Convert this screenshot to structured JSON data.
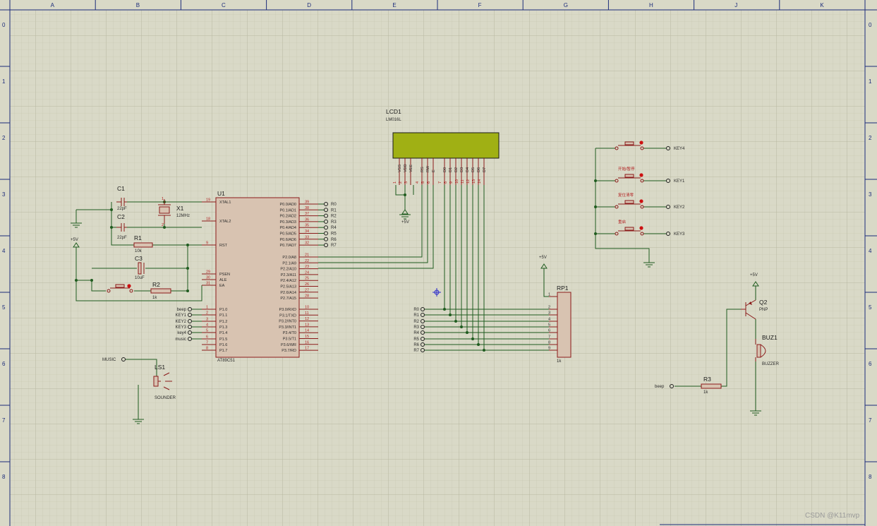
{
  "frame": {
    "columns": [
      "A",
      "B",
      "C",
      "D",
      "E",
      "F",
      "G",
      "H",
      "J",
      "K"
    ],
    "rows": [
      "0",
      "1",
      "2",
      "3",
      "4",
      "5",
      "6",
      "7",
      "8"
    ]
  },
  "components": {
    "u1": {
      "ref": "U1",
      "part": "AT89C51",
      "left_pins": [
        {
          "num": "19",
          "name": "XTAL1"
        },
        {
          "num": "18",
          "name": "XTAL2"
        },
        {
          "num": "9",
          "name": "RST"
        },
        {
          "num": "29",
          "name": "PSEN"
        },
        {
          "num": "30",
          "name": "ALE"
        },
        {
          "num": "31",
          "name": "EA"
        },
        {
          "num": "1",
          "name": "P1.0"
        },
        {
          "num": "2",
          "name": "P1.1"
        },
        {
          "num": "3",
          "name": "P1.2"
        },
        {
          "num": "4",
          "name": "P1.3"
        },
        {
          "num": "5",
          "name": "P1.4"
        },
        {
          "num": "6",
          "name": "P1.5"
        },
        {
          "num": "7",
          "name": "P1.6"
        },
        {
          "num": "8",
          "name": "P1.7"
        }
      ],
      "right_pins": [
        {
          "num": "39",
          "name": "P0.0/AD0"
        },
        {
          "num": "38",
          "name": "P0.1/AD1"
        },
        {
          "num": "37",
          "name": "P0.2/AD2"
        },
        {
          "num": "36",
          "name": "P0.3/AD3"
        },
        {
          "num": "35",
          "name": "P0.4/AD4"
        },
        {
          "num": "34",
          "name": "P0.5/AD5"
        },
        {
          "num": "33",
          "name": "P0.6/AD6"
        },
        {
          "num": "32",
          "name": "P0.7/AD7"
        },
        {
          "num": "21",
          "name": "P2.0/A8"
        },
        {
          "num": "22",
          "name": "P2.1/A9"
        },
        {
          "num": "23",
          "name": "P2.2/A10"
        },
        {
          "num": "24",
          "name": "P2.3/A11"
        },
        {
          "num": "25",
          "name": "P2.4/A12"
        },
        {
          "num": "26",
          "name": "P2.5/A13"
        },
        {
          "num": "27",
          "name": "P2.6/A14"
        },
        {
          "num": "28",
          "name": "P2.7/A15"
        },
        {
          "num": "10",
          "name": "P3.0/RXD"
        },
        {
          "num": "11",
          "name": "P3.1/TXD"
        },
        {
          "num": "12",
          "name": "P3.2/INT0"
        },
        {
          "num": "13",
          "name": "P3.3/INT1"
        },
        {
          "num": "14",
          "name": "P3.4/T0"
        },
        {
          "num": "15",
          "name": "P3.5/T1"
        },
        {
          "num": "16",
          "name": "P3.6/WR"
        },
        {
          "num": "17",
          "name": "P3.7/RD"
        }
      ]
    },
    "c1": {
      "ref": "C1",
      "value": "22pF"
    },
    "c2": {
      "ref": "C2",
      "value": "22pF"
    },
    "c3": {
      "ref": "C3",
      "value": "10uF"
    },
    "x1": {
      "ref": "X1",
      "value": "12MHz"
    },
    "r1": {
      "ref": "R1",
      "value": "10k"
    },
    "r2": {
      "ref": "R2",
      "value": "1k"
    },
    "r3": {
      "ref": "R3",
      "value": "1k"
    },
    "lcd1": {
      "ref": "LCD1",
      "part": "LM016L",
      "pin_names": [
        "VSS",
        "VDD",
        "VEE",
        "RS",
        "RW",
        "E",
        "D0",
        "D1",
        "D2",
        "D3",
        "D4",
        "D5",
        "D6",
        "D7"
      ],
      "pin_nums": [
        "1",
        "2",
        "3",
        "4",
        "5",
        "6",
        "7",
        "8",
        "9",
        "10",
        "11",
        "12",
        "13",
        "14"
      ]
    },
    "rp1": {
      "ref": "RP1",
      "value": "1k",
      "pins": [
        "1",
        "2",
        "3",
        "4",
        "5",
        "6",
        "7",
        "8",
        "9"
      ]
    },
    "q2": {
      "ref": "Q2",
      "part": "PNP"
    },
    "buz1": {
      "ref": "BUZ1",
      "part": "BUZZER"
    },
    "ls1": {
      "ref": "LS1",
      "part": "SOUNDER"
    }
  },
  "power": {
    "vcc": "+5V"
  },
  "net_labels": {
    "p0": [
      "R0",
      "R1",
      "R2",
      "R3",
      "R4",
      "R5",
      "R6",
      "R7"
    ],
    "p1": [
      "beep",
      "KEY1",
      "KEY2",
      "KEY3",
      "key4",
      "music"
    ],
    "keys": [
      "KEY4",
      "KEY1",
      "KEY2",
      "KEY3"
    ],
    "key_captions": [
      "开始/暂停",
      "复位清零",
      "重启"
    ],
    "music": "MUSIC",
    "beep": "beep"
  },
  "watermark": "CSDN @K11mvp"
}
